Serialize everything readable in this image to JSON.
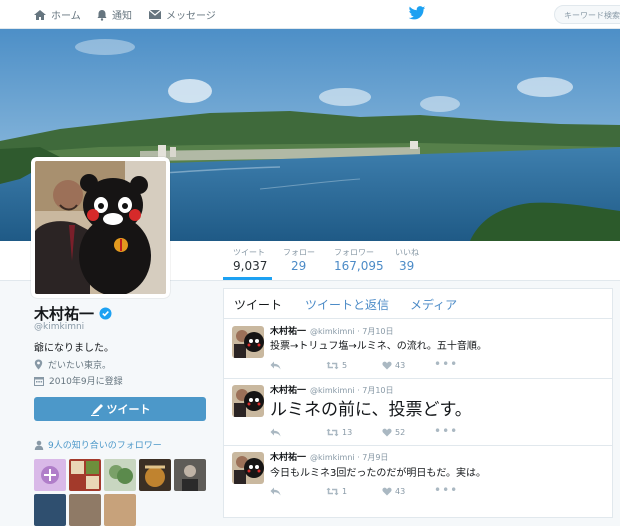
{
  "nav": {
    "home": "ホーム",
    "notifications": "通知",
    "messages": "メッセージ",
    "search_placeholder": "キーワード検索"
  },
  "stats": [
    {
      "label": "ツイート",
      "value": "9,037"
    },
    {
      "label": "フォロー",
      "value": "29"
    },
    {
      "label": "フォロワー",
      "value": "167,095"
    },
    {
      "label": "いいね",
      "value": "39"
    }
  ],
  "profile": {
    "name": "木村祐一",
    "handle": "@kimkimni",
    "bio": "爺になりました。",
    "location": "だいたい東京。",
    "joined": "2010年9月に登録",
    "tweet_button": "ツイート",
    "mutual_followers": "9人の知り合いのフォロワー"
  },
  "tabs": [
    "ツイート",
    "ツイートと返信",
    "メディア"
  ],
  "tweets": [
    {
      "name": "木村祐一",
      "handle": "@kimkimni",
      "date": "7月10日",
      "text": "投票→トリュフ塩→ルミネ、の流れ。五十音順。",
      "retweets": "5",
      "likes": "43"
    },
    {
      "name": "木村祐一",
      "handle": "@kimkimni",
      "date": "7月10日",
      "text": "ルミネの前に、投票どす。",
      "retweets": "13",
      "likes": "52"
    },
    {
      "name": "木村祐一",
      "handle": "@kimkimni",
      "date": "7月9日",
      "text": "今日もルミネ3回だったのだが明日もだ。実は。",
      "retweets": "1",
      "likes": "43"
    }
  ],
  "colors": {
    "accent": "#1da1f2",
    "link": "#4c8bc7",
    "button": "#4c98c9"
  }
}
